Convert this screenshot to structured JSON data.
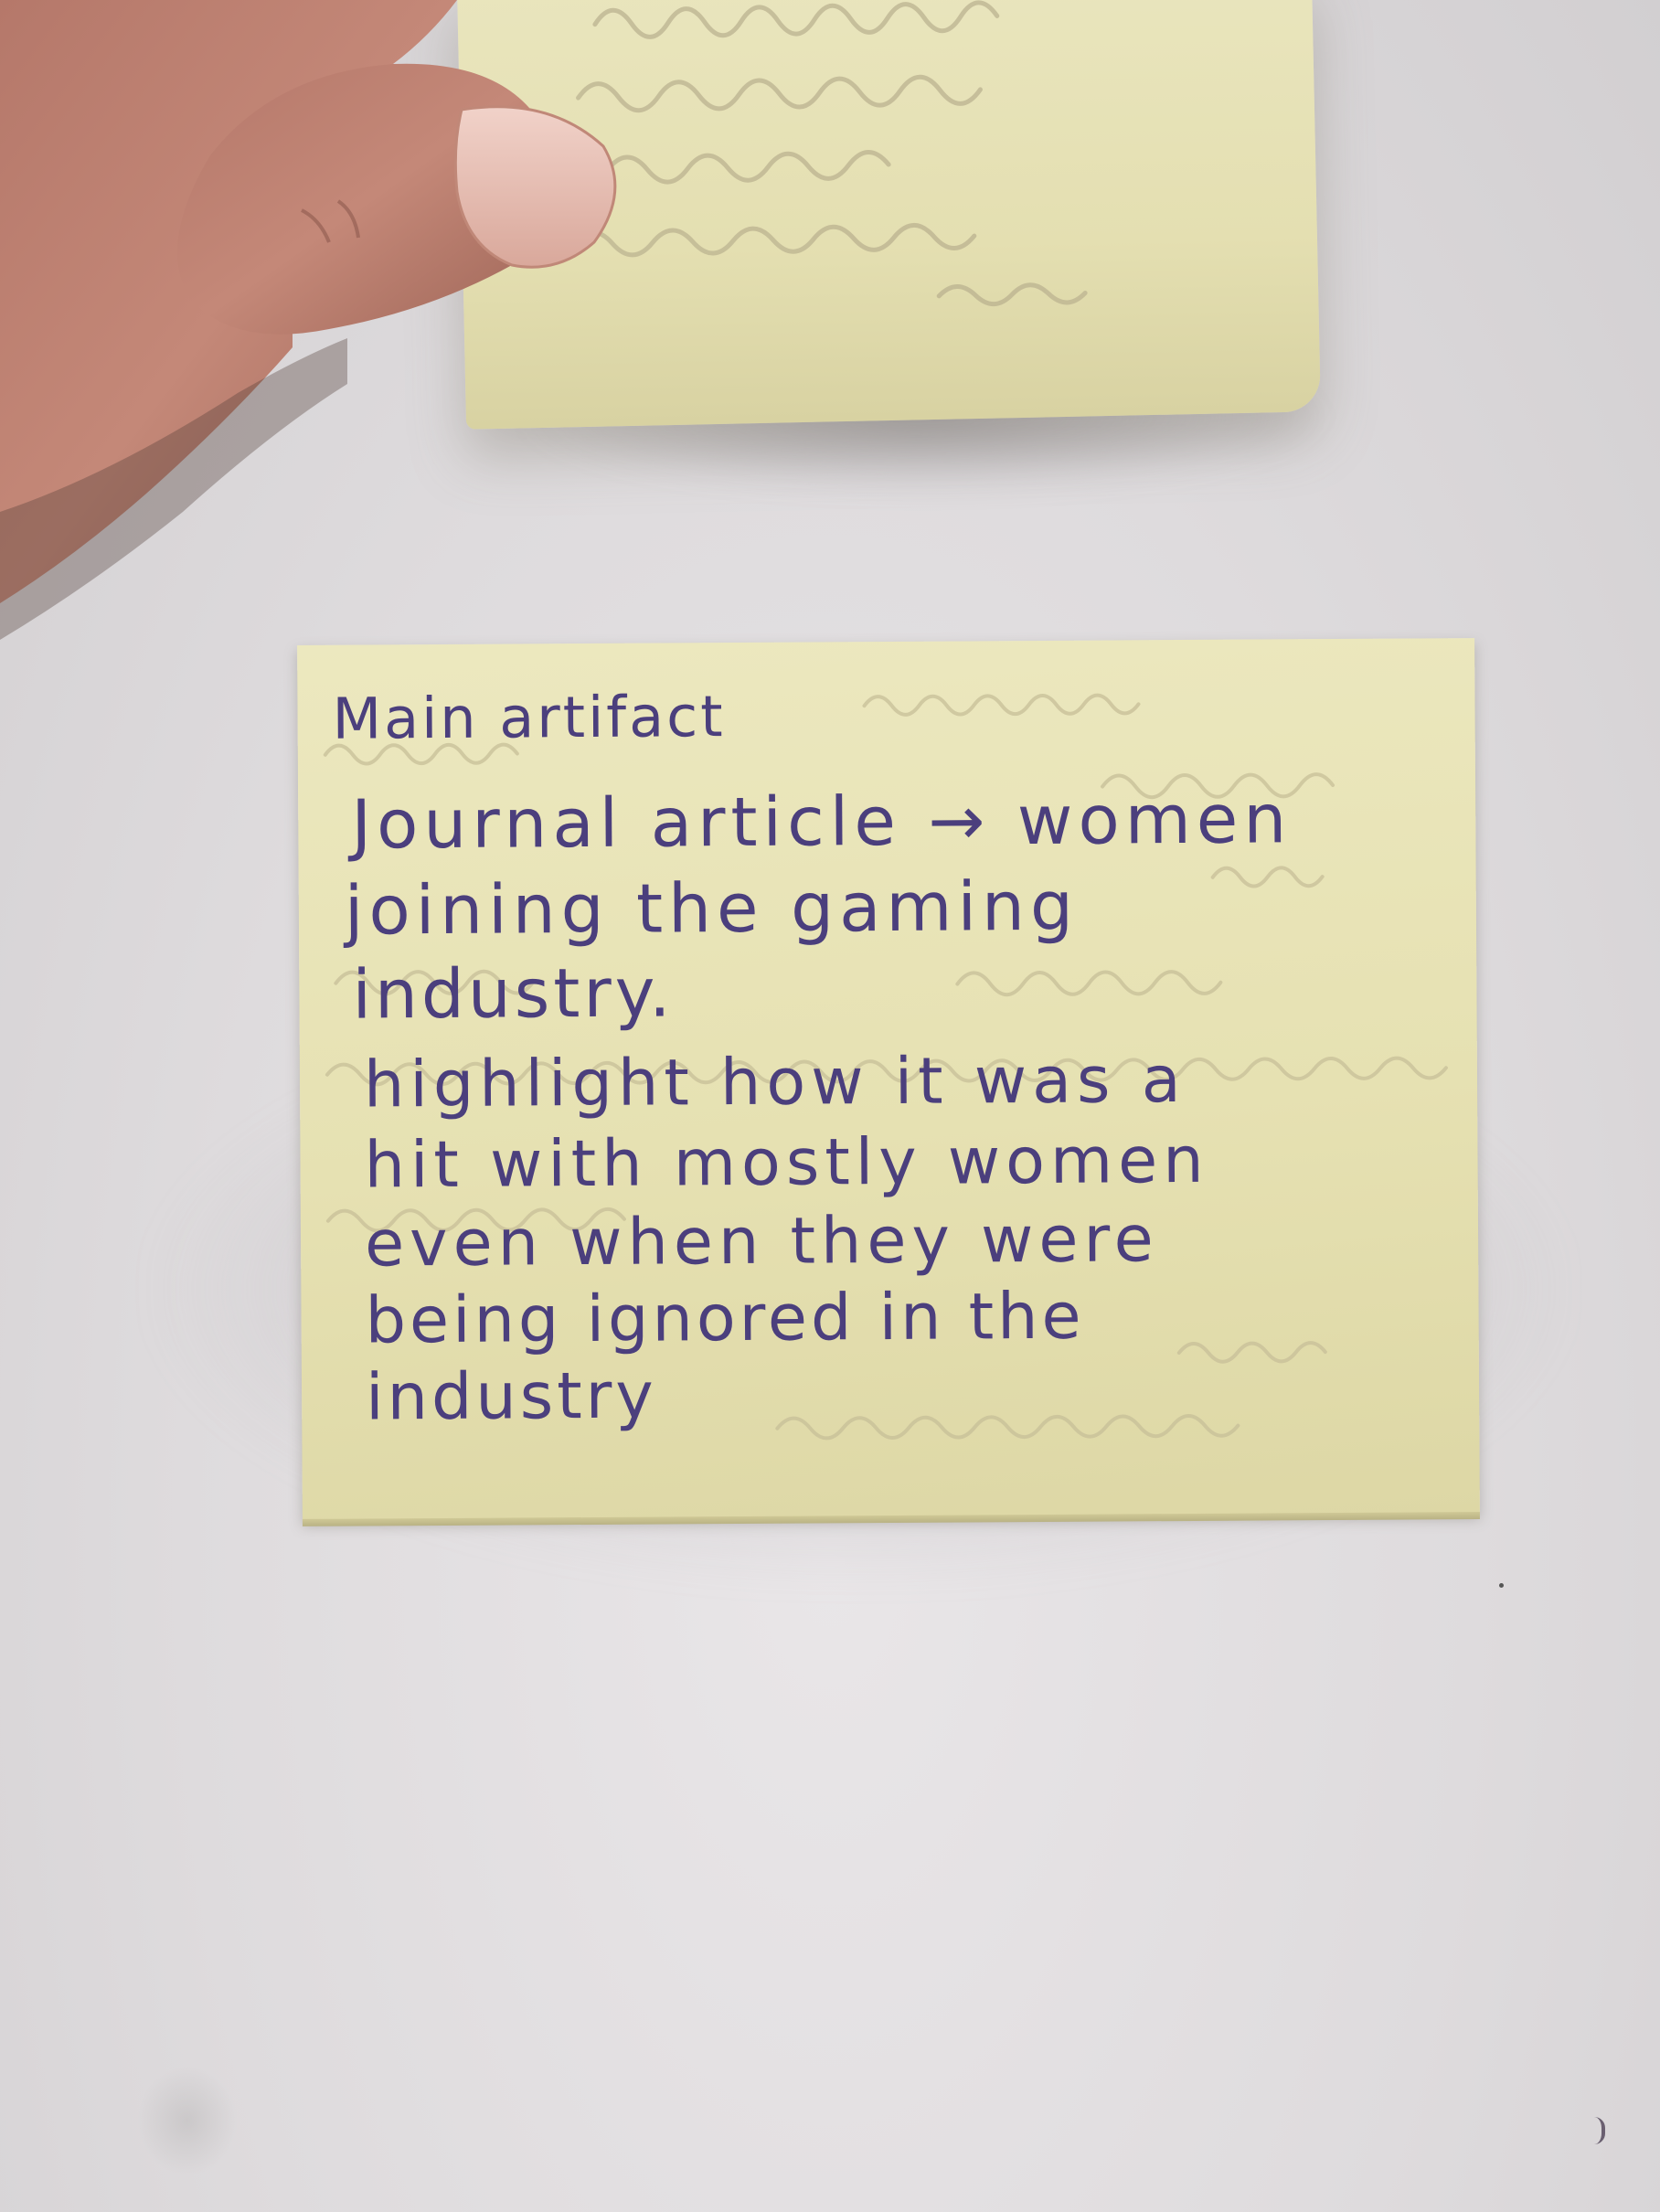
{
  "scene": {
    "description_free": true
  },
  "note": {
    "lines": [
      "Main artifact",
      "Journal article → women",
      "joining the gaming",
      "industry.",
      "highlight how it was a",
      "hit with mostly women",
      "even when they were",
      "being ignored in the",
      "industry"
    ],
    "ink_color": "#4b3f7d",
    "paper_color": "#e8e3b6"
  }
}
